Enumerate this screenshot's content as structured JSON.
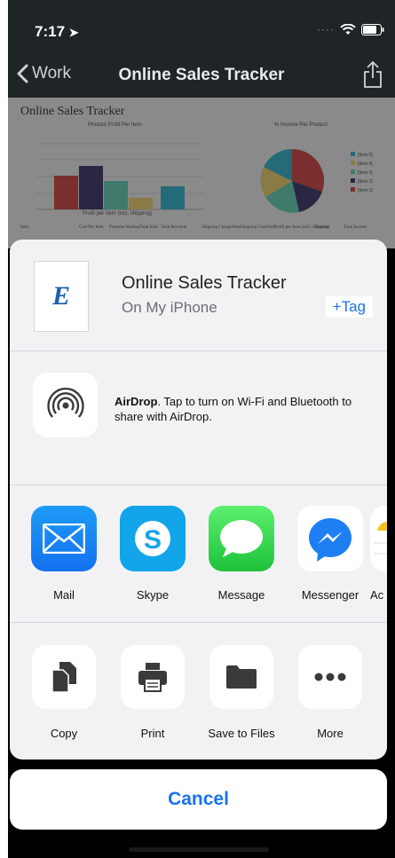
{
  "status": {
    "time": "7:17"
  },
  "nav": {
    "back_label": "Work",
    "title": "Online Sales Tracker"
  },
  "document": {
    "title": "Online Sales Tracker",
    "chart1_title": "Product Profit Per Item",
    "chart1_xlabel": "Profit per Item (incl. shipping)",
    "chart2_title": "% Income Per Product",
    "legend": [
      "[Item 5]",
      "[Item 4]",
      "[Item 3]",
      "[Item 2]",
      "[Item 1]"
    ],
    "columns": [
      "Item",
      "Cost Per Item",
      "Promote Markup",
      "Total Sold",
      "Total Revenue",
      "Shipping Charge/Item",
      "Shipping Cost/Item",
      "Profit per Item (excl. shipping)",
      "Returns",
      "Total Income"
    ]
  },
  "sheet": {
    "file_name": "Online Sales Tracker",
    "file_location": "On My iPhone",
    "file_badge": "E",
    "tag_label": "+Tag",
    "airdrop_title": "AirDrop",
    "airdrop_text": ". Tap to turn on Wi-Fi and Bluetooth to share with AirDrop.",
    "apps": [
      {
        "label": "Mail",
        "icon": "mail-icon"
      },
      {
        "label": "Skype",
        "icon": "skype-icon"
      },
      {
        "label": "Message",
        "icon": "message-icon"
      },
      {
        "label": "Messenger",
        "icon": "messenger-icon"
      },
      {
        "label": "Ac",
        "icon": "app-icon"
      }
    ],
    "actions": [
      {
        "label": "Copy",
        "icon": "copy-icon"
      },
      {
        "label": "Print",
        "icon": "print-icon"
      },
      {
        "label": "Save to Files",
        "icon": "folder-icon"
      },
      {
        "label": "More",
        "icon": "more-icon"
      }
    ],
    "cancel_label": "Cancel"
  },
  "colors": {
    "accent": "#1a73e8",
    "sheet_bg": "#f2f2f5",
    "navbar": "#1f2426"
  }
}
